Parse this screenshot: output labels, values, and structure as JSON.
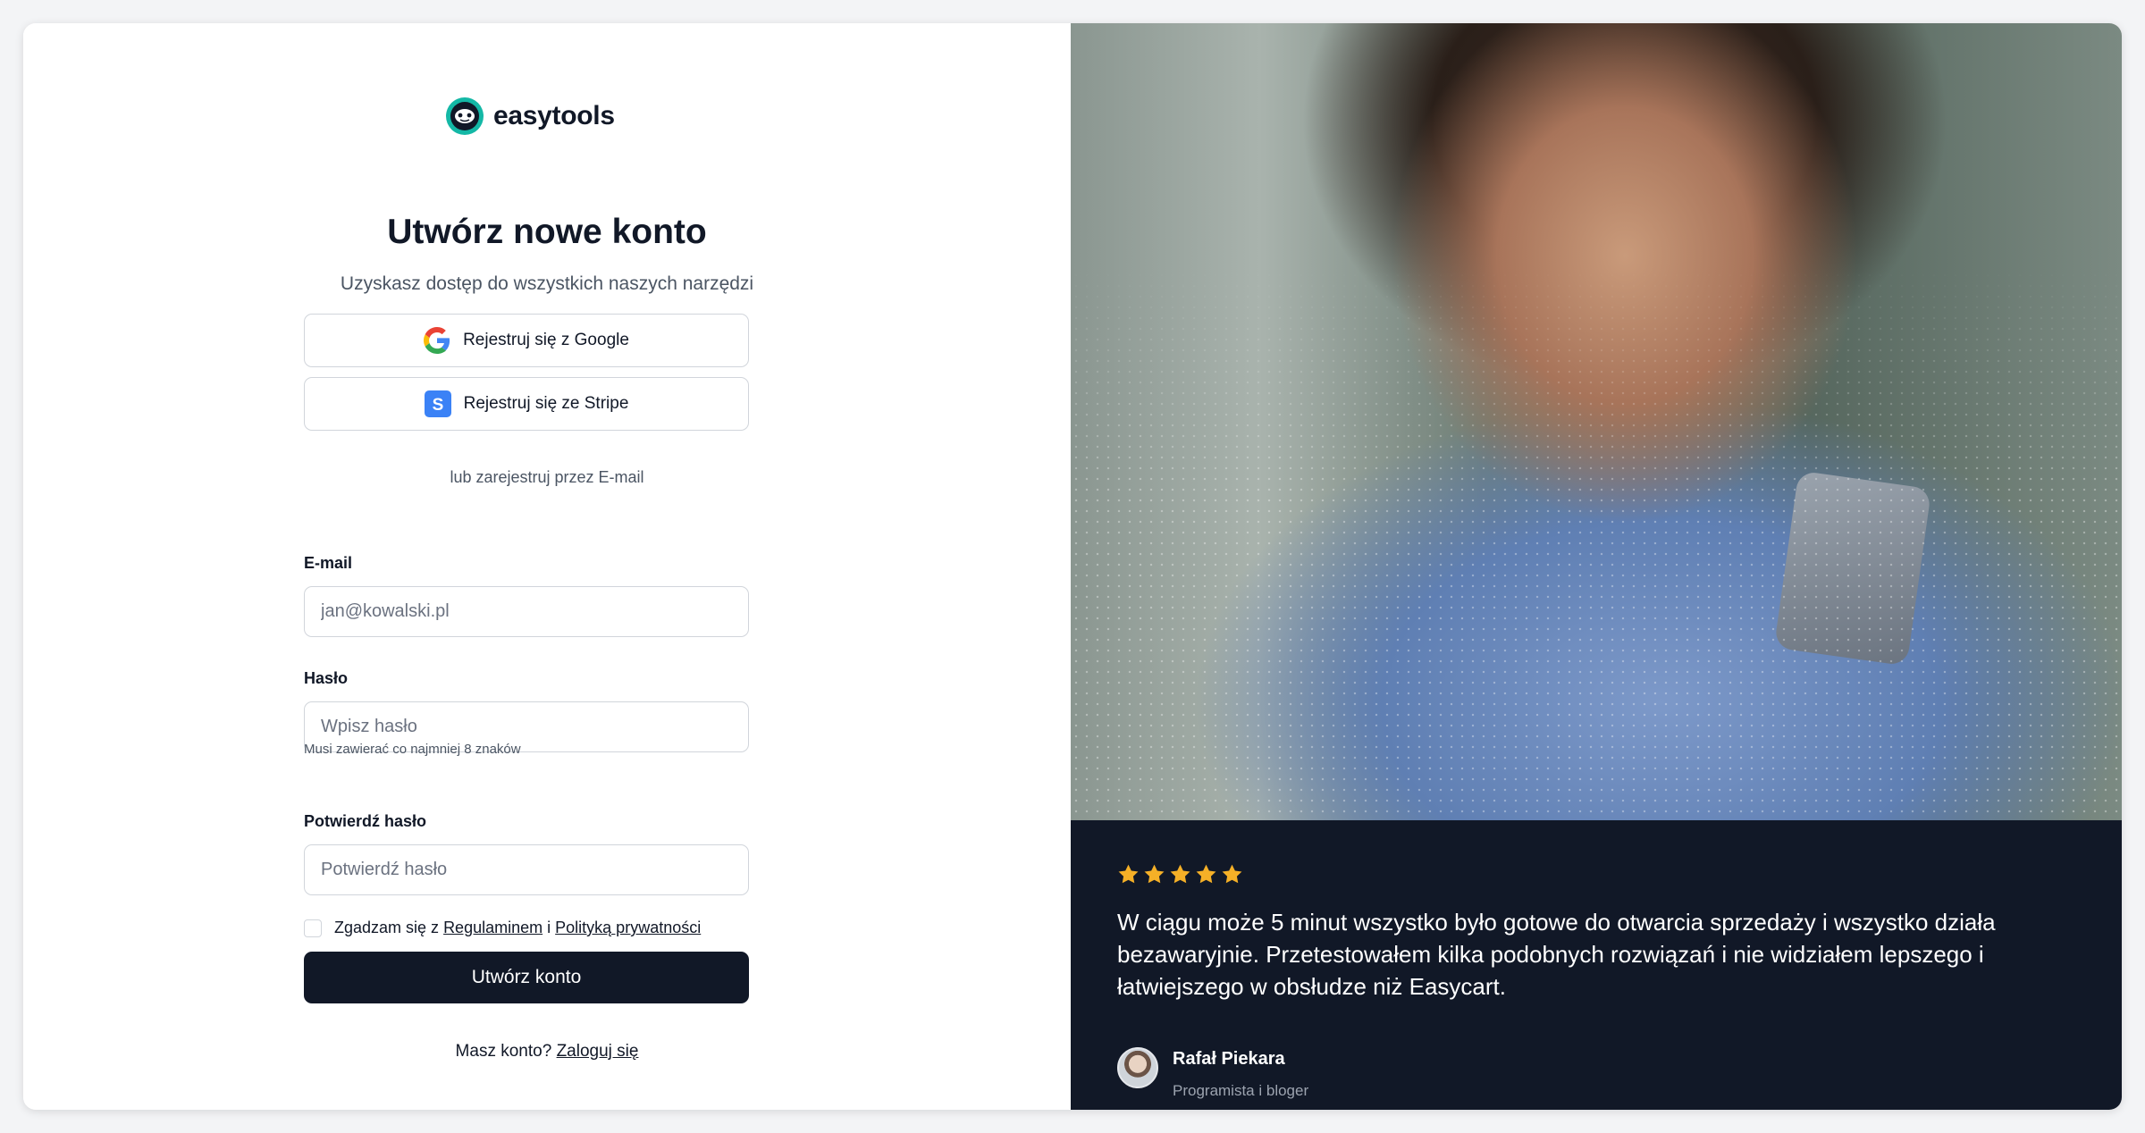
{
  "brand": {
    "name": "easytools",
    "accent": "#14b8a6"
  },
  "header": {
    "title": "Utwórz nowe konto",
    "subtitle": "Uzyskasz dostęp do wszystkich naszych narzędzi"
  },
  "social": {
    "google_label": "Rejestruj się z Google",
    "stripe_label": "Rejestruj się ze Stripe",
    "divider_text": "lub zarejestruj przez E-mail"
  },
  "form": {
    "email_label": "E-mail",
    "email_placeholder": "jan@kowalski.pl",
    "password_label": "Hasło",
    "password_placeholder": "Wpisz hasło",
    "password_hint": "Musi zawierać co najmniej 8 znaków",
    "confirm_label": "Potwierdź hasło",
    "confirm_placeholder": "Potwierdź hasło",
    "terms_prefix": "Zgadzam się z",
    "terms_link": "Regulaminem",
    "terms_and": "i",
    "privacy_link": "Polityką prywatności",
    "submit_label": "Utwórz konto",
    "login_prompt": "Masz konto?",
    "login_link": "Zaloguj się"
  },
  "testimonial": {
    "rating": 5,
    "star_color": "#f5b027",
    "quote": "W ciągu może 5 minut wszystko było gotowe do otwarcia sprzedaży i wszystko działa bezawaryjnie. Przetestowałem kilka podobnych rozwiązań i nie widziałem lepszego i łatwiejszego w obsłudze niż Easycart.",
    "author_name": "Rafał Piekara",
    "author_role": "Programista i bloger"
  },
  "colors": {
    "primary": "#111827",
    "border": "#d1d5db",
    "stripe": "#3b82f6"
  }
}
